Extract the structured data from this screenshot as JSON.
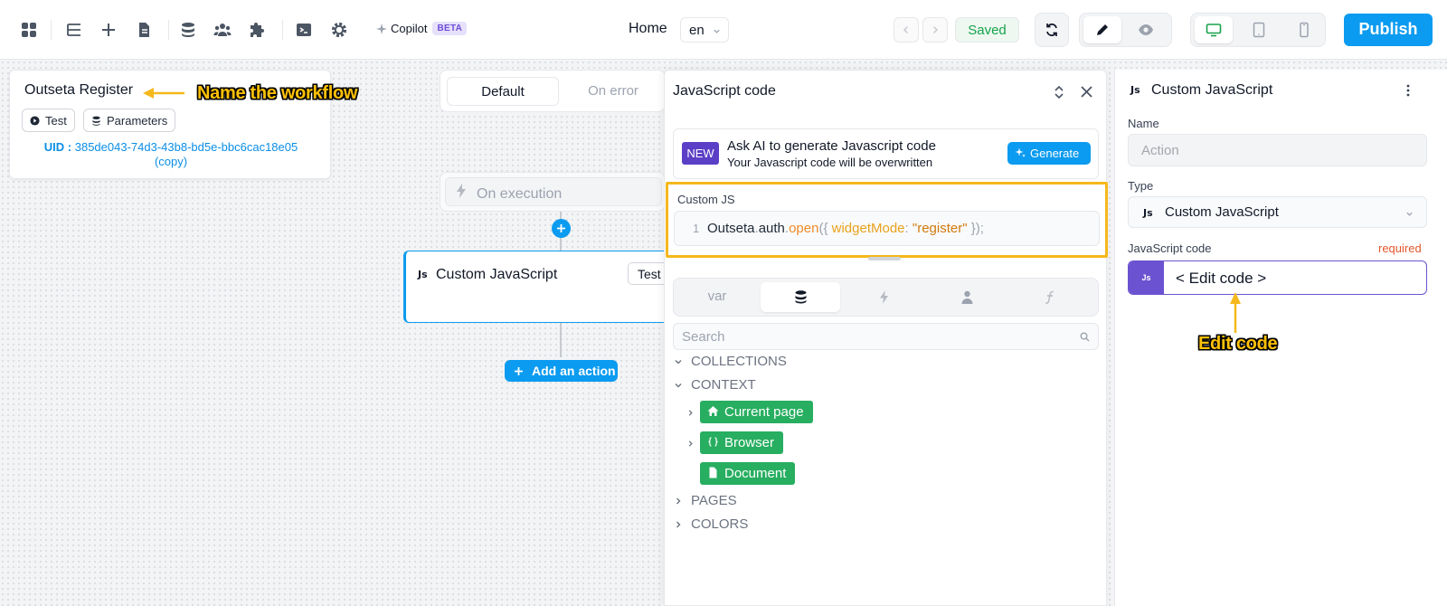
{
  "toolbar": {
    "copilot_label": "Copilot",
    "beta_label": "BETA",
    "page_name": "Home",
    "language": "en",
    "saved_label": "Saved",
    "publish_label": "Publish"
  },
  "workflow": {
    "title": "Outseta Register",
    "test_label": "Test",
    "parameters_label": "Parameters",
    "uid_prefix": "UID :",
    "uid_value": "385de043-74d3-43b8-bd5e-bbc6cac18e05",
    "copy_label": "(copy)"
  },
  "annotations": {
    "name_workflow": "Name the workflow",
    "edit_code": "Edit code"
  },
  "canvas": {
    "tabs": [
      "Default",
      "On error"
    ],
    "trigger_label": "On execution",
    "action_badge": "Js",
    "action_title": "Custom JavaScript",
    "action_test_label": "Test",
    "add_action_label": "Add an action"
  },
  "js_panel": {
    "title": "JavaScript code",
    "new_badge": "NEW",
    "ai_title": "Ask AI to generate Javascript code",
    "ai_subtitle": "Your Javascript code will be overwritten",
    "generate_label": "Generate",
    "custom_js_label": "Custom JS",
    "line_number": "1",
    "code": {
      "obj": "Outseta",
      "dot1": ".",
      "prop": "auth",
      "dot2": ".",
      "fn": "open",
      "open": "({ ",
      "key": "widgetMode",
      "colon": ": ",
      "str": "\"register\"",
      "close": " });"
    },
    "tool_tabs": [
      "var",
      "database-icon",
      "bolt-icon",
      "user-icon",
      "function-icon"
    ],
    "search_placeholder": "Search",
    "tree": {
      "collections": "COLLECTIONS",
      "context": "CONTEXT",
      "current_page": "Current page",
      "browser": "Browser",
      "document": "Document",
      "pages": "PAGES",
      "colors": "COLORS"
    }
  },
  "props": {
    "badge": "Js",
    "title": "Custom JavaScript",
    "name_label": "Name",
    "name_placeholder": "Action",
    "type_label": "Type",
    "type_badge": "Js",
    "type_value": "Custom JavaScript",
    "code_label": "JavaScript code",
    "required_label": "required",
    "code_badge": "Js",
    "edit_code_label": "< Edit code >"
  },
  "colors": {
    "accent": "#0b9bf0",
    "annotation": "#f5b81c",
    "pill_green": "#27ae60",
    "purple": "#6b52d1",
    "saved_green": "#16a34a"
  }
}
